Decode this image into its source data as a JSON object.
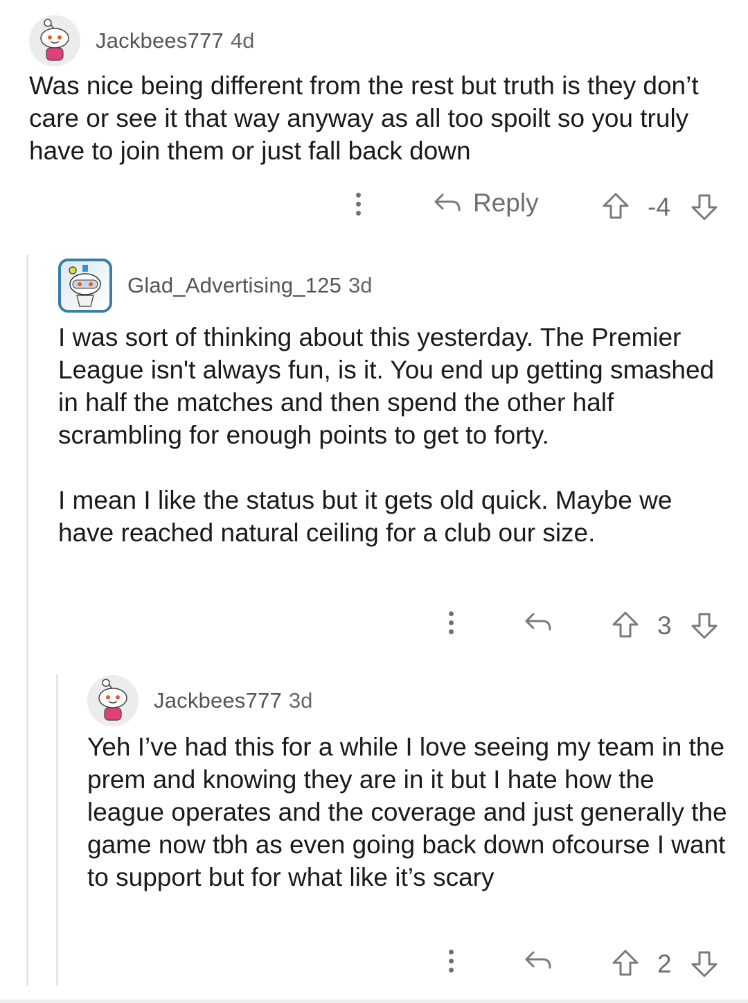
{
  "comments": [
    {
      "username": "Jackbees777",
      "age": "4d",
      "avatar_icon": "snoo-avatar-pink",
      "body": [
        "Was nice being different from the rest but truth is they don’t care or see it that way anyway as all too spoilt so you truly have to join them or just fall back down"
      ],
      "reply_label": "Reply",
      "score": "-4"
    },
    {
      "username": "Glad_Advertising_125",
      "age": "3d",
      "avatar_icon": "snoo-avatar-astronaut",
      "body": [
        "I was sort of thinking about this yesterday. The Premier League isn't always fun, is it. You end up getting smashed in half the matches and then spend the other half scrambling for enough points to get to forty.",
        "I mean I like the status but it gets old quick. Maybe we have reached natural ceiling for a club our size."
      ],
      "score": "3"
    },
    {
      "username": "Jackbees777",
      "age": "3d",
      "avatar_icon": "snoo-avatar-pink",
      "body": [
        "Yeh I’ve had this for a while I love seeing my team in the prem and knowing they are in it but I hate how the league operates and the coverage and just generally the game now tbh as even going back down ofcourse I want to support but for what like it’s scary"
      ],
      "score": "2"
    }
  ],
  "colors": {
    "text": "#1a1a1a",
    "meta": "#555555",
    "action": "#6e6e6e",
    "thread_line": "#e6e6e6",
    "avatar_pink": "#e0407a"
  }
}
